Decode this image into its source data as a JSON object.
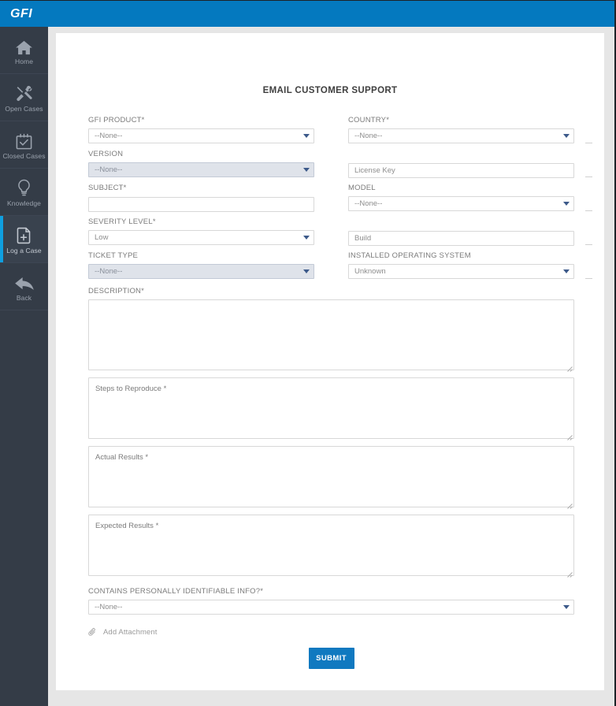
{
  "header": {
    "brand": "GFI",
    "accent_color": "#0479bf"
  },
  "sidebar": {
    "background_color": "#343c47",
    "active_accent_color": "#0f9fe0",
    "items": [
      {
        "label": "Home",
        "icon": "home-icon",
        "active": false
      },
      {
        "label": "Open Cases",
        "icon": "tools-icon",
        "active": false
      },
      {
        "label": "Closed Cases",
        "icon": "calendar-check-icon",
        "active": false
      },
      {
        "label": "Knowledge",
        "icon": "lightbulb-icon",
        "active": false
      },
      {
        "label": "Log a Case",
        "icon": "file-plus-icon",
        "active": true
      },
      {
        "label": "Back",
        "icon": "arrow-back-icon",
        "active": false
      }
    ]
  },
  "form": {
    "title": "EMAIL CUSTOMER SUPPORT",
    "left_fields": [
      {
        "label": "GFI PRODUCT*",
        "type": "select",
        "value": "--None--",
        "disabled": false
      },
      {
        "label": "VERSION",
        "type": "select",
        "value": "--None--",
        "disabled": true
      },
      {
        "label": "SUBJECT*",
        "type": "text",
        "value": "",
        "placeholder": ""
      },
      {
        "label": "SEVERITY LEVEL*",
        "type": "select",
        "value": "Low",
        "disabled": false
      },
      {
        "label": "TICKET TYPE",
        "type": "select",
        "value": "--None--",
        "disabled": true
      }
    ],
    "right_fields": [
      {
        "label": "COUNTRY*",
        "type": "select",
        "value": "--None--",
        "disabled": false
      },
      {
        "label": "",
        "type": "text",
        "value": "",
        "placeholder": "License Key"
      },
      {
        "label": "MODEL",
        "type": "select",
        "value": "--None--",
        "disabled": false
      },
      {
        "label": "",
        "type": "text",
        "value": "",
        "placeholder": "Build"
      },
      {
        "label": "INSTALLED OPERATING SYSTEM",
        "type": "select",
        "value": "Unknown",
        "disabled": false
      }
    ],
    "description": {
      "label": "DESCRIPTION*",
      "value": "",
      "placeholder": ""
    },
    "textareas": [
      {
        "placeholder": "Steps to Reproduce *",
        "value": ""
      },
      {
        "placeholder": "Actual Results *",
        "value": ""
      },
      {
        "placeholder": "Expected Results *",
        "value": ""
      }
    ],
    "pii": {
      "label": "CONTAINS PERSONALLY IDENTIFIABLE INFO?*",
      "value": "--None--"
    },
    "attachment": {
      "label": "Add Attachment",
      "icon": "paperclip-icon"
    },
    "submit": {
      "label": "SUBMIT",
      "color": "#1079c0"
    }
  }
}
